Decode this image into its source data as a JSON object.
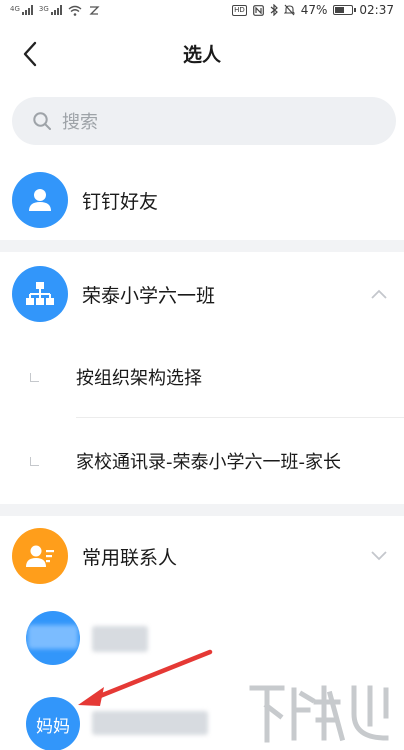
{
  "status_bar": {
    "battery_pct": "47%",
    "battery_level": 0.47,
    "time": "02:37",
    "hd_badge": "HD",
    "net_tag_1": "4G",
    "net_tag_2": "3G",
    "icons": [
      "signal-1-icon",
      "signal-2-icon",
      "wifi-icon",
      "rest-icon",
      "nfc-icon",
      "bluetooth-icon",
      "mute-icon",
      "battery-icon"
    ]
  },
  "nav": {
    "title": "选人",
    "back_icon": "chevron-left-icon"
  },
  "search": {
    "placeholder": "搜索",
    "icon": "search-icon"
  },
  "sections": {
    "dingtalk_friends": {
      "label": "钉钉好友",
      "icon": "person-icon"
    },
    "class": {
      "label": "荣泰小学六一班",
      "icon": "org-chart-icon",
      "sub_items": [
        {
          "label": "按组织架构选择"
        },
        {
          "label": "家校通讯录-荣泰小学六一班-家长"
        }
      ]
    },
    "frequent": {
      "label": "常用联系人",
      "icon": "contact-card-icon",
      "contacts": [
        {
          "name_hidden": true
        },
        {
          "avatar_text": "妈妈",
          "name_hidden": true
        }
      ]
    }
  },
  "colors": {
    "accent_blue": "#3296fa",
    "accent_orange": "#ff9e1b",
    "annotation_red": "#e53935",
    "section_divider": "#f2f3f5"
  }
}
